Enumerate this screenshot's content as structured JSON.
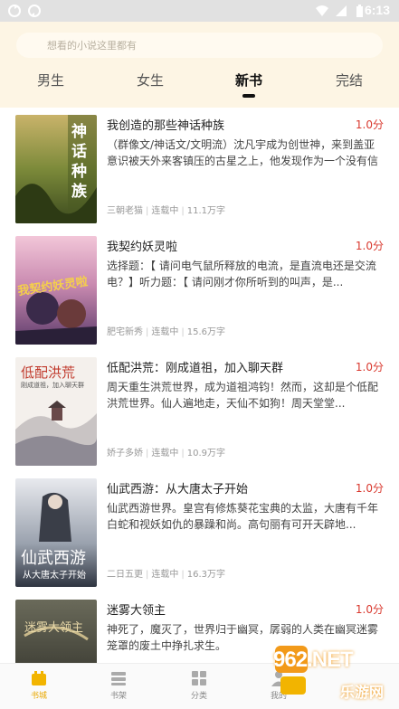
{
  "status": {
    "time": "6:13"
  },
  "search": {
    "placeholder": "想看的小说这里都有"
  },
  "tabs": [
    {
      "label": "男生"
    },
    {
      "label": "女生"
    },
    {
      "label": "新书"
    },
    {
      "label": "完结"
    }
  ],
  "active_tab": "新书",
  "books": [
    {
      "title": "我创造的那些神话种族",
      "score": "1.0分",
      "desc": "（群像文/神话文/文明流）沈凡宇成为创世神，来到盖亚意识被天外来客镇压的古星之上，他发现作为一个没有信徒的神...",
      "author": "三朝老猫",
      "status": "连载中",
      "words": "11.1万字",
      "cover_text": "神话种族"
    },
    {
      "title": "我契约妖灵啦",
      "score": "1.0分",
      "desc": "选择题：【 请问电气鼠所释放的电流，是直流电还是交流电？】听力题：【 请问刚才你所听到的叫声，是...",
      "author": "肥宅新秀",
      "status": "连载中",
      "words": "15.6万字",
      "cover_text": "我契约妖灵啦"
    },
    {
      "title": "低配洪荒：刚成道祖，加入聊天群",
      "score": "1.0分",
      "desc": "周天重生洪荒世界，成为道祖鸿钧！然而，这却是个低配洪荒世界。仙人遍地走，天仙不如狗！周天堂堂...",
      "author": "娇子多娇",
      "status": "连载中",
      "words": "10.9万字",
      "cover_text": "低配洪荒",
      "cover_sub": "刚成道祖，加入聊天群"
    },
    {
      "title": "仙武西游：从大唐太子开始",
      "score": "1.0分",
      "desc": "仙武西游世界。皇宫有修炼葵花宝典的太监，大唐有千年白蛇和视妖如仇的暴躁和尚。高句丽有可开天辟地...",
      "author": "二日五更",
      "status": "连载中",
      "words": "16.3万字",
      "cover_text": "仙武西游",
      "cover_sub": "从大唐太子开始"
    },
    {
      "title": "迷雾大领主",
      "score": "1.0分",
      "desc": "神死了，魔灭了，世界归于幽冥，孱弱的人类在幽冥迷雾笼罩的废土中挣扎求生。",
      "author": "",
      "status": "",
      "words": "",
      "cover_text": "迷雾大领主"
    }
  ],
  "tabbar": [
    {
      "label": "书城",
      "icon": "bookstore-icon"
    },
    {
      "label": "书架",
      "icon": "bookshelf-icon"
    },
    {
      "label": "分类",
      "icon": "category-icon"
    },
    {
      "label": "我的",
      "icon": "profile-icon"
    }
  ],
  "watermark": {
    "text": "962.NET",
    "sub": "乐游网"
  },
  "colors": {
    "accent": "#e9a800",
    "score": "#d9392f",
    "header_bg": "#fdf5e4"
  }
}
